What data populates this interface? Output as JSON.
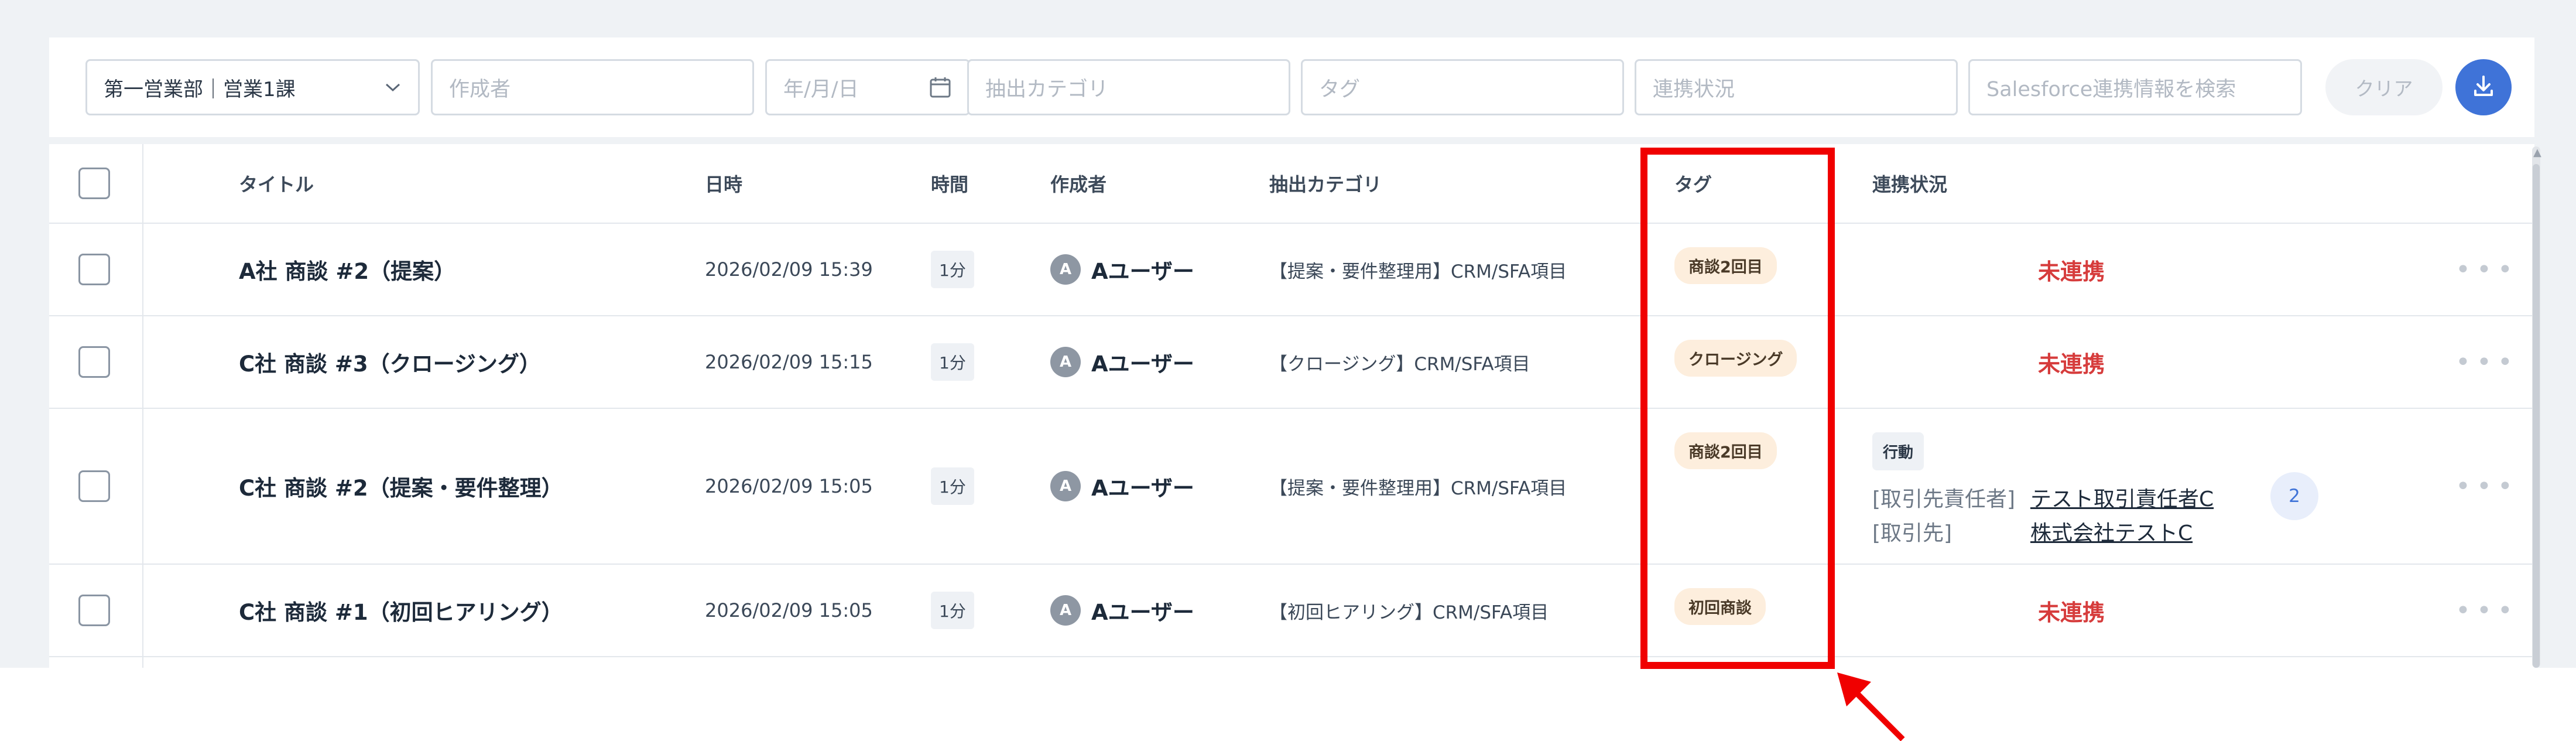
{
  "filters": {
    "department": "第一営業部｜営業1課",
    "author_placeholder": "作成者",
    "date_placeholder": "年/月/日",
    "category_placeholder": "抽出カテゴリ",
    "tag_placeholder": "タグ",
    "status_placeholder": "連携状況",
    "salesforce_placeholder": "Salesforce連携情報を検索",
    "clear_label": "クリア",
    "download_icon": "download-icon"
  },
  "table": {
    "headers": {
      "title": "タイトル",
      "datetime": "日時",
      "duration": "時間",
      "author": "作成者",
      "category": "抽出カテゴリ",
      "tag": "タグ",
      "status": "連携状況"
    },
    "rows": [
      {
        "title": "A社 商談 #2（提案）",
        "datetime": "2026/02/09 15:39",
        "duration": "1分",
        "avatar": "A",
        "author": "Aユーザー",
        "category": "【提案・要件整理用】CRM/SFA項目",
        "tag": "商談2回目",
        "status": "未連携"
      },
      {
        "title": "C社 商談 #3（クロージング）",
        "datetime": "2026/02/09 15:15",
        "duration": "1分",
        "avatar": "A",
        "author": "Aユーザー",
        "category": "【クロージング】CRM/SFA項目",
        "tag": "クロージング",
        "status": "未連携"
      },
      {
        "title": "C社 商談 #2（提案・要件整理）",
        "datetime": "2026/02/09 15:05",
        "duration": "1分",
        "avatar": "A",
        "author": "Aユーザー",
        "category": "【提案・要件整理用】CRM/SFA項目",
        "tag": "商談2回目",
        "status_linked": {
          "chip": "行動",
          "contact_label": "[取引先責任者]",
          "contact_value": "テスト取引責任者C",
          "account_label": "[取引先]",
          "account_value": "株式会社テストC",
          "count": "2"
        }
      },
      {
        "title": "C社 商談 #1（初回ヒアリング）",
        "datetime": "2026/02/09 15:05",
        "duration": "1分",
        "avatar": "A",
        "author": "Aユーザー",
        "category": "【初回ヒアリング】CRM/SFA項目",
        "tag": "初回商談",
        "status": "未連携"
      }
    ]
  },
  "colors": {
    "accent": "#3f73d8",
    "unlinked": "#d63c3c",
    "tag_bg": "#fdeedd",
    "annotation": "#f00000"
  }
}
